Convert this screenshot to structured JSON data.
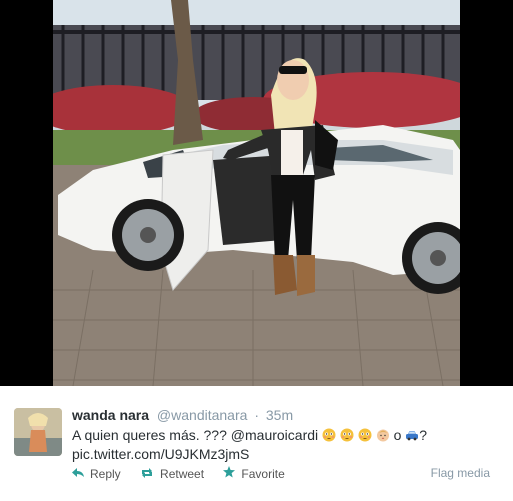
{
  "photo": {
    "alt_subject": "woman-with-car-photo"
  },
  "tweet": {
    "fullname": "wanda nara",
    "username": "@wanditanara",
    "separator": "·",
    "time": "35m",
    "text_prefix": "A quien queres más. ??? ",
    "mention": "@mauroicardi",
    "text_middle": " o ",
    "text_suffix": "?",
    "link": "pic.twitter.com/U9JKMz3jmS",
    "emojis": [
      "flushed-face",
      "flushed-face",
      "flushed-face",
      "baby-face",
      "car"
    ]
  },
  "actions": {
    "reply": "Reply",
    "retweet": "Retweet",
    "favorite": "Favorite",
    "flag": "Flag media"
  },
  "colors": {
    "icon_teal": "#2d9f9a",
    "muted": "#8899a6",
    "text": "#292f33"
  }
}
